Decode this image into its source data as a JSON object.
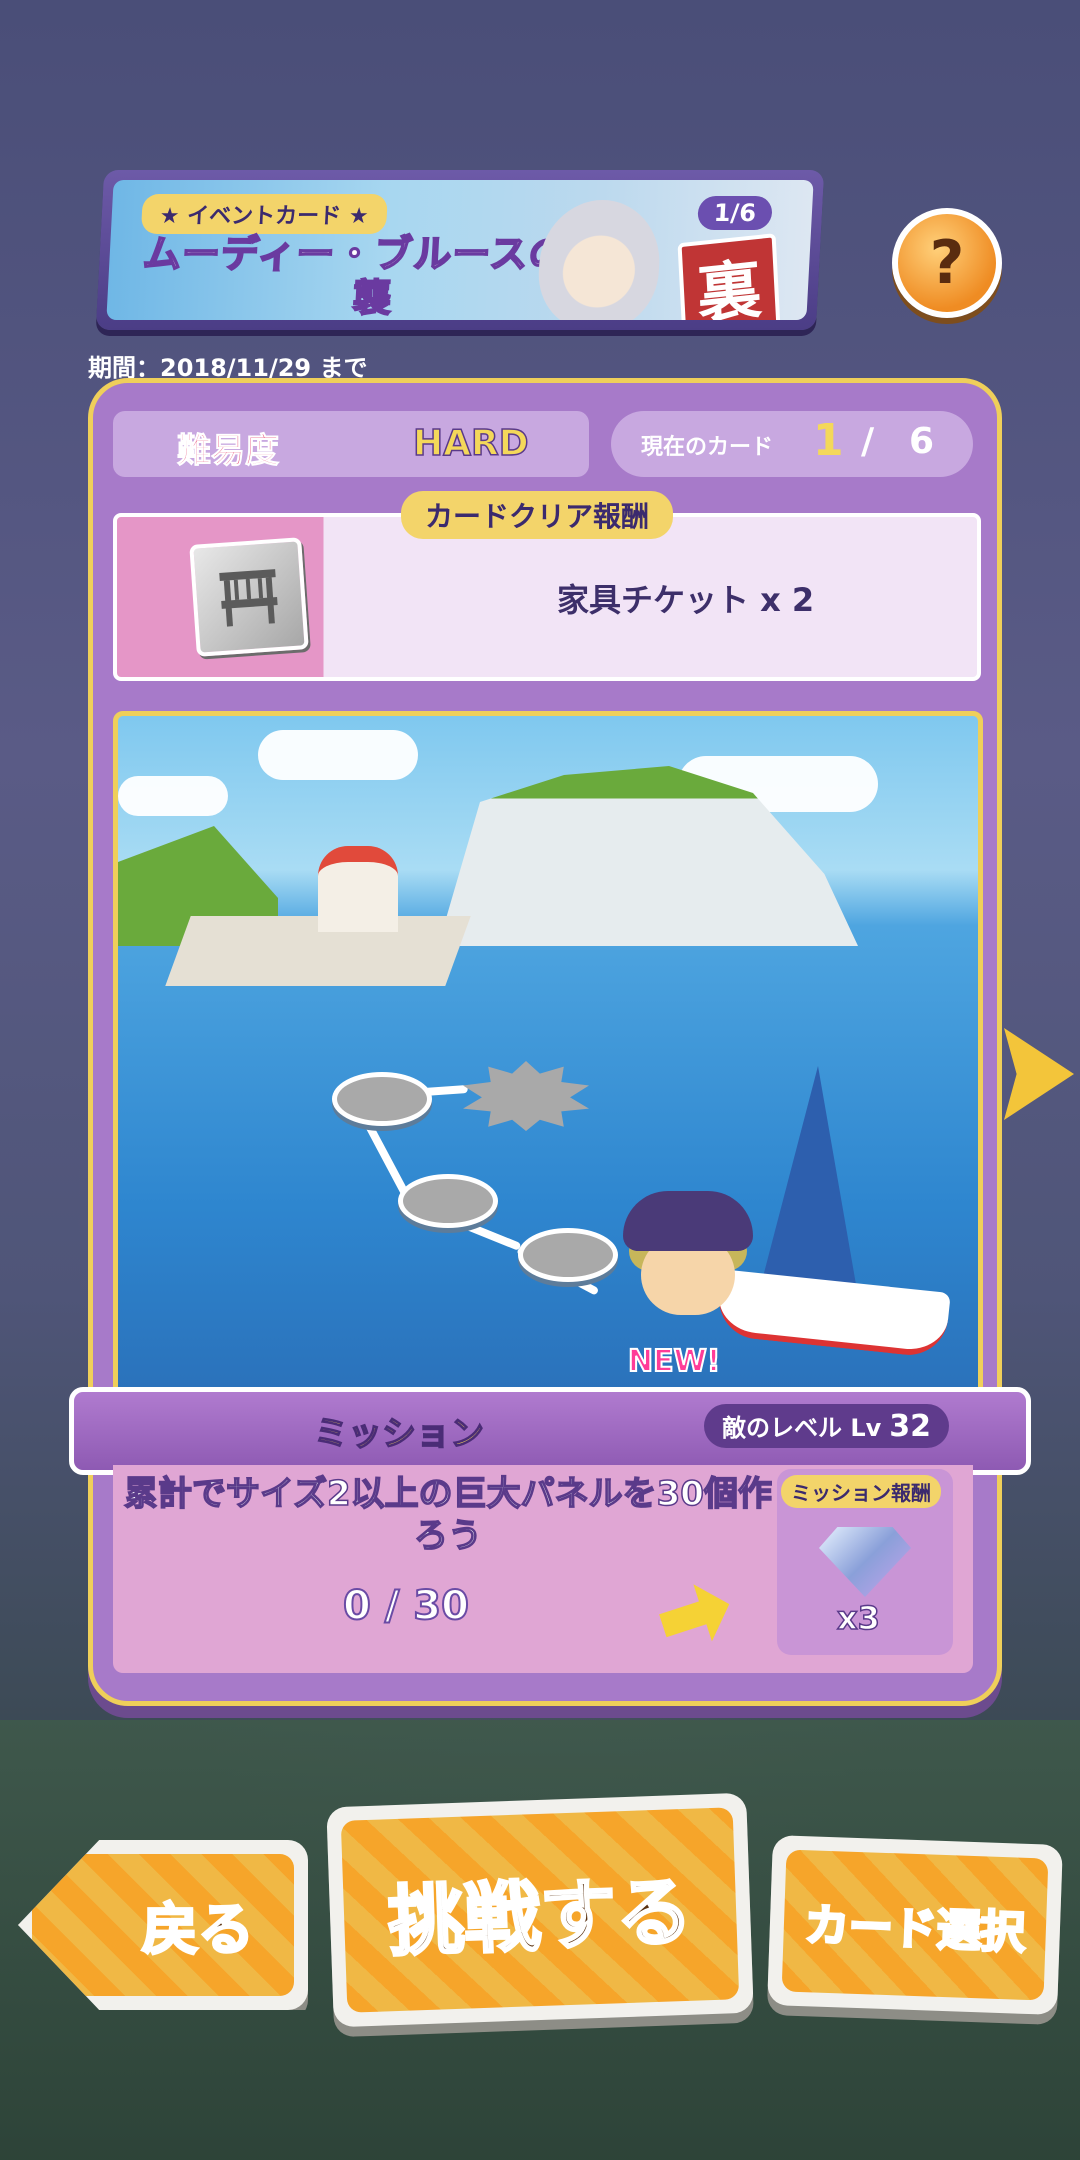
{
  "banner": {
    "event_label": "★ イベントカード ★",
    "title": "ムーディー・ブルースの逆襲",
    "card_count": "1/6",
    "ura_label": "裏"
  },
  "help_label": "?",
  "period": "期間：2018/11/29 まで",
  "difficulty": {
    "label": "難易度",
    "value": "HARD"
  },
  "current_card": {
    "label": "現在のカード",
    "current": "1",
    "separator": "/",
    "total": "6"
  },
  "card_reward": {
    "tag": "カードクリア報酬",
    "item": "家具チケット x 2"
  },
  "map": {
    "new_badge": "NEW!"
  },
  "mission": {
    "title": "ミッション",
    "enemy_level_label": "敵のレベル Lv",
    "enemy_level_value": "32",
    "text": "累計でサイズ2以上の巨大パネルを30個作ろう",
    "progress": "0 / 30",
    "reward_tag": "ミッション報酬",
    "reward_qty": "x3"
  },
  "buttons": {
    "back": "戻る",
    "challenge": "挑戦する",
    "card_select": "カード選択"
  },
  "colors": {
    "panel": "#a77ac9",
    "accent_gold": "#efcf5a",
    "button_orange": "#f6a52a"
  }
}
